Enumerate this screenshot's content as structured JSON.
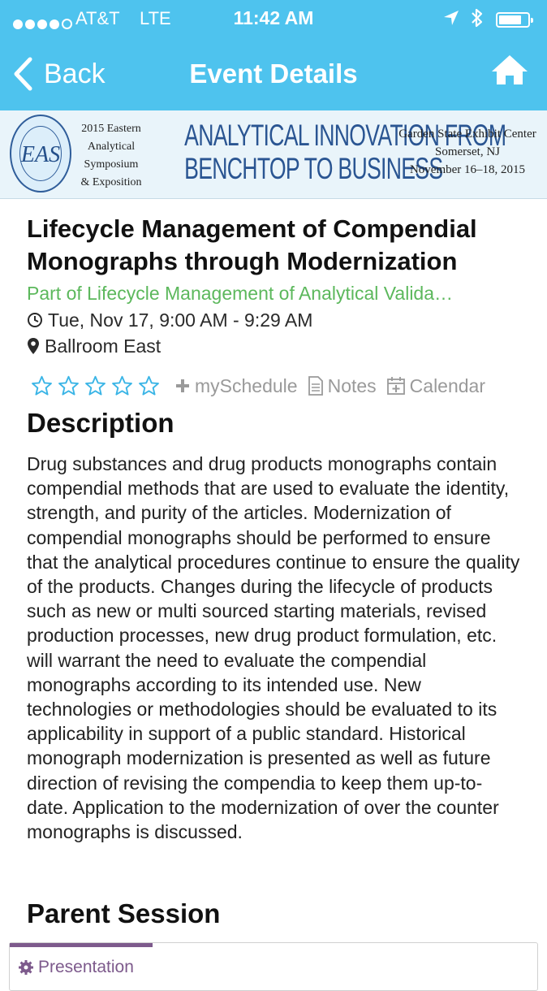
{
  "status_bar": {
    "carrier": "AT&T",
    "network": "LTE",
    "time": "11:42 AM",
    "signal_bars": 4,
    "signal_max": 5,
    "battery_level": 0.7
  },
  "nav": {
    "back_label": "Back",
    "title": "Event Details",
    "home_icon": "home-icon"
  },
  "banner": {
    "seal_monogram": "EAS",
    "symposium_lines": [
      "2015 Eastern",
      "Analytical",
      "Symposium",
      "& Exposition"
    ],
    "headline_lines": [
      "ANALYTICAL INNOVATION FROM",
      "BENCHTOP TO BUSINESS"
    ],
    "venue_lines": [
      "Garden State Exhibit Center",
      "Somerset, NJ",
      "November 16–18, 2015"
    ]
  },
  "event": {
    "title": "Lifecycle Management of Compendial Monographs through Modernization",
    "parent_link": "Part of Lifecycle Management of Analytical Valida…",
    "datetime": "Tue, Nov 17, 9:00 AM - 9:29 AM",
    "location": "Ballroom East"
  },
  "actions": {
    "rating": 0,
    "rating_max": 5,
    "schedule_label": "mySchedule",
    "notes_label": "Notes",
    "calendar_label": "Calendar"
  },
  "description": {
    "heading": "Description",
    "body": "Drug substances and drug products monographs contain compendial methods that are used to evaluate the identity, strength, and purity of the articles. Modernization of compendial monographs should be performed to ensure that the analytical procedures continue to ensure the quality of the products. Changes during the lifecycle of products such as new or multi sourced starting materials, revised production processes, new drug product formulation, etc. will warrant the need to evaluate the compendial monographs according to its intended use. New technologies or methodologies should be evaluated to its applicability in support of a public standard. Historical monograph modernization is presented as well as future direction of revising the compendia to keep them up-to-date. Application to the modernization of over the counter monographs is discussed."
  },
  "parent_session": {
    "heading": "Parent Session",
    "type_label": "Presentation",
    "accent_color": "#7d5a8c"
  },
  "colors": {
    "header_bg": "#4ec3ee",
    "link_green": "#5cb85c",
    "star_blue": "#3bb5e6",
    "action_gray": "#9a9a9a"
  }
}
